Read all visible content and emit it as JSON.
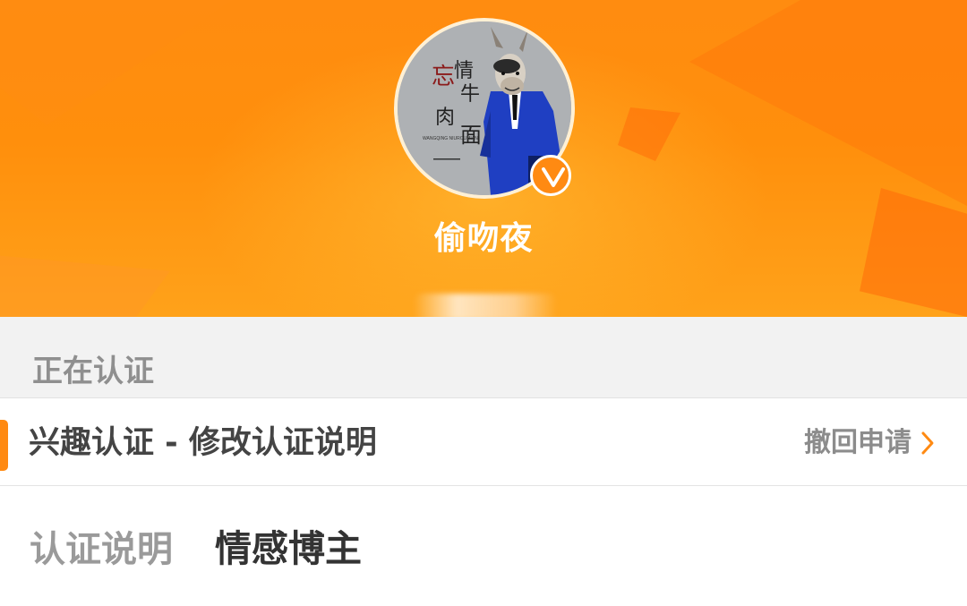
{
  "profile": {
    "username": "偷吻夜",
    "avatar": {
      "icon": "donkey-mask-figure-in-blue-suit",
      "text_chars": [
        "忘",
        "情",
        "牛",
        "肉",
        "面"
      ],
      "small_caption": "WANGQING NIUROUMIAN"
    },
    "verified_icon": "v-badge-icon"
  },
  "status": {
    "section_title": "正在认证"
  },
  "certification": {
    "title": "兴趣认证 - 修改认证说明",
    "revoke_label": "撤回申请",
    "revoke_icon": "chevron-right-icon"
  },
  "description": {
    "label": "认证说明",
    "value": "情感博主"
  },
  "colors": {
    "brand_orange": "#ff8a12",
    "section_bg": "#f2f2f2",
    "label_gray": "#8f8f8f"
  }
}
